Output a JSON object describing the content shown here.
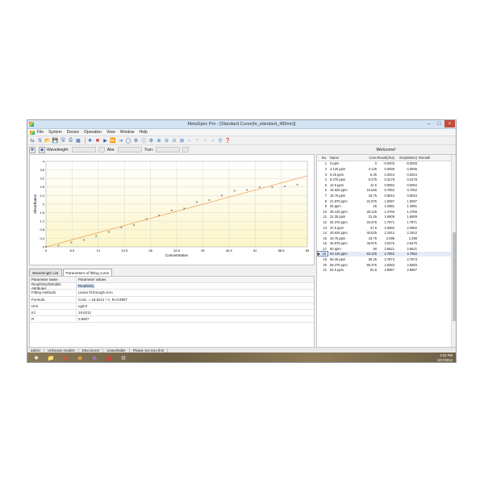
{
  "window": {
    "title": "MetaSpec Pro - [Standard Curve(fe_standard_483nm)]"
  },
  "menu": [
    "File",
    "System",
    "Device",
    "Operation",
    "View",
    "Window",
    "Help"
  ],
  "info": {
    "wavelength_label": "Wavelength:",
    "abs_label": "Abs:",
    "trans_label": "Tran:",
    "welcome": "Welcome!"
  },
  "chart_data": {
    "type": "scatter",
    "xlabel": "Concentration",
    "ylabel": "Absorbance",
    "xlim": [
      0,
      65
    ],
    "ylim": [
      0,
      4
    ],
    "xticks": [
      "0",
      "6.5",
      "13",
      "19.5",
      "26",
      "32.5",
      "39",
      "45.5",
      "52",
      "58.5",
      "65"
    ],
    "yticks": [
      "0",
      "0.4",
      "0.8",
      "1.2",
      "1.6",
      "2",
      "2.4",
      "2.8",
      "3.2",
      "3.6",
      "4"
    ],
    "points": {
      "x": [
        0,
        3.125,
        6.25,
        9.375,
        12.5,
        15.625,
        18.75,
        21.875,
        25,
        28.125,
        31.25,
        34.375,
        37.5,
        40.625,
        43.75,
        46.875,
        50,
        53.125,
        56.25,
        59.375,
        62.5
      ],
      "y": [
        -0.0003,
        0.0596,
        0.2044,
        0.3178,
        0.5084,
        0.7062,
        0.9044,
        1.0097,
        1.2981,
        1.4766,
        1.6909,
        1.7871,
        2.0882,
        2.1912,
        2.399,
        2.6275,
        2.6621,
        2.7962,
        2.7873,
        2.8383,
        2.8967
      ]
    },
    "fit": {
      "slope": 0.0511,
      "intercept": 0
    },
    "grid": true
  },
  "tabs": [
    "Wavelength List",
    "Parameters of fitting curve"
  ],
  "params": {
    "header": {
      "name": "Parameter name",
      "value": "Parameter values"
    },
    "rows": [
      {
        "name": "ReadOnly/Writable Attributes",
        "value": "ReadOnly"
      },
      {
        "name": "Fitting methods",
        "value": "Linear fit through zero"
      },
      {
        "name": "Formula",
        "value": "Conc. = 19.5212 * A, R=0.9907"
      },
      {
        "name": "Unit",
        "value": "ug/ml"
      },
      {
        "name": "K1",
        "value": "19.5212"
      },
      {
        "name": "R",
        "value": "0.9907"
      }
    ]
  },
  "table": {
    "columns": [
      "No.",
      "Name",
      "Conc",
      "Result(Abs)",
      "Abs(483nm)",
      "Remark"
    ],
    "current_row": 18,
    "rows": [
      [
        "1",
        "0 ppm",
        "0",
        "-0.0003",
        "-0.0003",
        ""
      ],
      [
        "2",
        "3.125 ppm",
        "3.125",
        "0.0596",
        "0.0596",
        ""
      ],
      [
        "3",
        "6.25 ppm",
        "6.25",
        "0.2044",
        "0.2044",
        ""
      ],
      [
        "4",
        "9.375 ppm",
        "9.375",
        "0.3178",
        "0.3178",
        ""
      ],
      [
        "5",
        "12.5 ppm",
        "12.5",
        "0.5084",
        "0.5084",
        ""
      ],
      [
        "6",
        "15.625 ppm",
        "15.625",
        "0.7062",
        "0.7062",
        ""
      ],
      [
        "7",
        "18.75 ppm",
        "18.75",
        "0.9044",
        "0.9044",
        ""
      ],
      [
        "8",
        "21.875 ppm",
        "21.875",
        "1.0097",
        "1.0097",
        ""
      ],
      [
        "9",
        "25 ppm",
        "25",
        "1.2981",
        "1.2981",
        ""
      ],
      [
        "10",
        "28.125 ppm",
        "28.125",
        "1.4766",
        "1.4766",
        ""
      ],
      [
        "11",
        "31.25 ppm",
        "31.25",
        "1.6909",
        "1.6909",
        ""
      ],
      [
        "12",
        "34.375 ppm",
        "34.375",
        "1.7871",
        "1.7871",
        ""
      ],
      [
        "13",
        "37.5 ppm",
        "37.5",
        "2.0882",
        "2.0882",
        ""
      ],
      [
        "14",
        "40.625 ppm",
        "40.625",
        "2.1912",
        "2.1912",
        ""
      ],
      [
        "15",
        "43.75 ppm",
        "43.75",
        "2.399",
        "2.399",
        ""
      ],
      [
        "16",
        "46.875 ppm",
        "46.875",
        "2.6275",
        "2.6275",
        ""
      ],
      [
        "17",
        "50 ppm",
        "50",
        "2.6621",
        "2.6621",
        ""
      ],
      [
        "18",
        "53.125 ppm",
        "53.125",
        "2.7962",
        "2.7962",
        ""
      ],
      [
        "19",
        "56.25 ppm",
        "56.25",
        "2.7873",
        "2.7873",
        ""
      ],
      [
        "20",
        "59.375 ppm",
        "59.375",
        "2.8383",
        "2.8383",
        ""
      ],
      [
        "21",
        "62.5 ppm",
        "62.5",
        "2.8967",
        "2.8967",
        ""
      ]
    ]
  },
  "status": [
    "admin",
    "Unknown models",
    "Disconnect",
    "Unworkable",
    "Please set zero first"
  ],
  "tray": {
    "time": "4:34 PM",
    "date": "6/17/2013"
  }
}
